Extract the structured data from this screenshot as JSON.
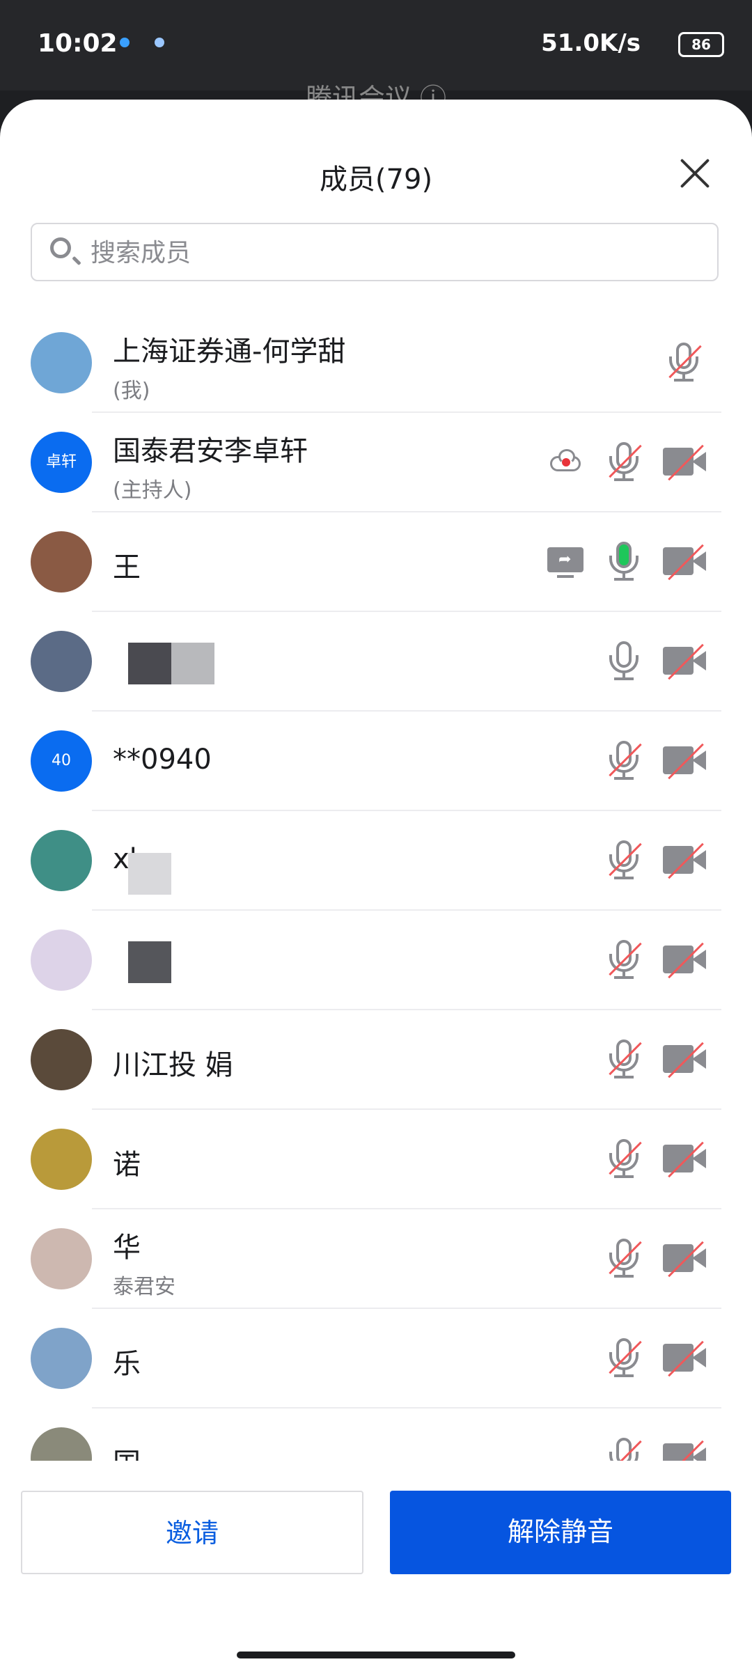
{
  "status_bar": {
    "time": "10:02",
    "net_speed": "51.0K/s",
    "battery": "86"
  },
  "behind": {
    "title": "腾讯会议 ⓘ"
  },
  "sheet": {
    "title": "成员(79)",
    "search_placeholder": "搜索成员"
  },
  "members": [
    {
      "name": "上海证券通-何学甜",
      "role": "(我)",
      "avatar_color": "#6fa6d6",
      "mic": "muted",
      "cam": "none",
      "extra": ""
    },
    {
      "name": "国泰君安李卓轩",
      "role": "(主持人)",
      "avatar_text": "卓轩",
      "avatar_color": "#0a6cf0",
      "mic": "muted",
      "cam": "off",
      "extra": "cloud-record"
    },
    {
      "name": "王",
      "role": "",
      "avatar_color": "#8a5a44",
      "mic": "active",
      "cam": "off",
      "extra": "screen-share"
    },
    {
      "name": "",
      "role": "",
      "avatar_color": "#5b6b86",
      "mic": "on",
      "cam": "off",
      "extra": ""
    },
    {
      "name": "**0940",
      "role": "",
      "avatar_text": "40",
      "avatar_color": "#0a6cf0",
      "mic": "muted",
      "cam": "off",
      "extra": ""
    },
    {
      "name": "xl",
      "role": "",
      "avatar_color": "#3f8f86",
      "mic": "muted",
      "cam": "off",
      "extra": ""
    },
    {
      "name": "",
      "role": "",
      "avatar_color": "#ddd3e8",
      "mic": "muted",
      "cam": "off",
      "extra": ""
    },
    {
      "name": "川江投 娟",
      "role": "",
      "avatar_color": "#5a4a3a",
      "mic": "muted",
      "cam": "off",
      "extra": ""
    },
    {
      "name": "诺",
      "role": "",
      "avatar_color": "#b99a3a",
      "mic": "muted",
      "cam": "off",
      "extra": ""
    },
    {
      "name": "华",
      "role": "泰君安",
      "avatar_color": "#cdb8b0",
      "mic": "muted",
      "cam": "off",
      "extra": ""
    },
    {
      "name": "乐",
      "role": "",
      "avatar_color": "#7fa3c9",
      "mic": "muted",
      "cam": "off",
      "extra": ""
    },
    {
      "name": "国",
      "role": "",
      "avatar_color": "#8a8a7a",
      "mic": "muted",
      "cam": "off",
      "extra": ""
    }
  ],
  "buttons": {
    "invite": "邀请",
    "unmute": "解除静音"
  }
}
